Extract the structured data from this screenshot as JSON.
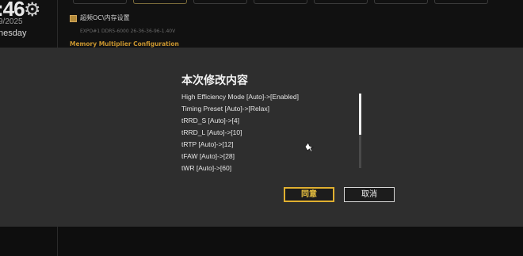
{
  "background": {
    "clock": {
      "time_text": ":46",
      "date_text": "9/2025",
      "weekday_text": "nesday"
    },
    "icons": {
      "settings": "gear-icon",
      "breadcrumb": "folder-icon",
      "cursor": "mouse-pointer-icon"
    },
    "breadcrumb_text": "超频OC\\内存设置",
    "expo_text": "EXPO#1 DDR5-6000 26-36-36-96-1.40V",
    "section_heading": "Memory Multiplier Configuration"
  },
  "dialog": {
    "title": "本次修改内容",
    "changes": [
      "High Efficiency Mode [Auto]->[Enabled]",
      "Timing Preset [Auto]->[Relax]",
      "tRRD_S [Auto]->[4]",
      "tRRD_L [Auto]->[10]",
      "tRTP [Auto]->[12]",
      "tFAW [Auto]->[28]",
      "tWR [Auto]->[60]"
    ],
    "scroll_position": 0,
    "confirm_label": "同意",
    "cancel_label": "取消"
  },
  "colors": {
    "accent": "#e0b030",
    "dialog_bg": "#2e2e2e",
    "section_heading": "#c8942e"
  }
}
